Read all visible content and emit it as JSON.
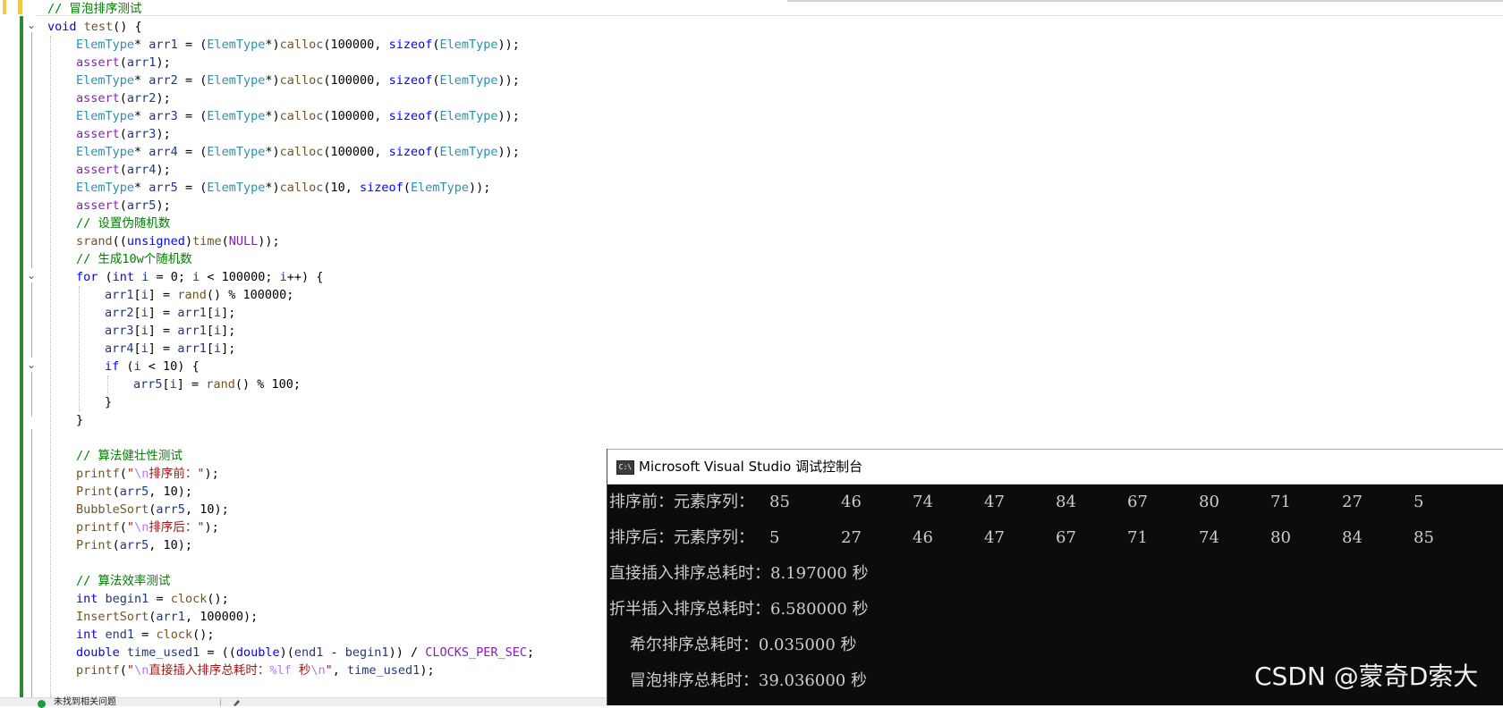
{
  "editor": {
    "lines": [
      {
        "indent": 0,
        "spans": [
          {
            "t": "// 冒泡排序测试",
            "c": "cm"
          }
        ]
      },
      {
        "indent": 0,
        "spans": [
          {
            "t": "void",
            "c": "kw"
          },
          {
            "t": " "
          },
          {
            "t": "test",
            "c": "fn"
          },
          {
            "t": "() {"
          }
        ]
      },
      {
        "indent": 1,
        "spans": [
          {
            "t": "ElemType",
            "c": "ty"
          },
          {
            "t": "* "
          },
          {
            "t": "arr1",
            "c": "vr"
          },
          {
            "t": " = ("
          },
          {
            "t": "ElemType",
            "c": "ty"
          },
          {
            "t": "*)"
          },
          {
            "t": "calloc",
            "c": "fn"
          },
          {
            "t": "(100000, "
          },
          {
            "t": "sizeof",
            "c": "kw"
          },
          {
            "t": "("
          },
          {
            "t": "ElemType",
            "c": "ty"
          },
          {
            "t": "));"
          }
        ]
      },
      {
        "indent": 1,
        "spans": [
          {
            "t": "assert",
            "c": "mc"
          },
          {
            "t": "("
          },
          {
            "t": "arr1",
            "c": "vr"
          },
          {
            "t": ");"
          }
        ]
      },
      {
        "indent": 1,
        "spans": [
          {
            "t": "ElemType",
            "c": "ty"
          },
          {
            "t": "* "
          },
          {
            "t": "arr2",
            "c": "vr"
          },
          {
            "t": " = ("
          },
          {
            "t": "ElemType",
            "c": "ty"
          },
          {
            "t": "*)"
          },
          {
            "t": "calloc",
            "c": "fn"
          },
          {
            "t": "(100000, "
          },
          {
            "t": "sizeof",
            "c": "kw"
          },
          {
            "t": "("
          },
          {
            "t": "ElemType",
            "c": "ty"
          },
          {
            "t": "));"
          }
        ]
      },
      {
        "indent": 1,
        "spans": [
          {
            "t": "assert",
            "c": "mc"
          },
          {
            "t": "("
          },
          {
            "t": "arr2",
            "c": "vr"
          },
          {
            "t": ");"
          }
        ]
      },
      {
        "indent": 1,
        "spans": [
          {
            "t": "ElemType",
            "c": "ty"
          },
          {
            "t": "* "
          },
          {
            "t": "arr3",
            "c": "vr"
          },
          {
            "t": " = ("
          },
          {
            "t": "ElemType",
            "c": "ty"
          },
          {
            "t": "*)"
          },
          {
            "t": "calloc",
            "c": "fn"
          },
          {
            "t": "(100000, "
          },
          {
            "t": "sizeof",
            "c": "kw"
          },
          {
            "t": "("
          },
          {
            "t": "ElemType",
            "c": "ty"
          },
          {
            "t": "));"
          }
        ]
      },
      {
        "indent": 1,
        "spans": [
          {
            "t": "assert",
            "c": "mc"
          },
          {
            "t": "("
          },
          {
            "t": "arr3",
            "c": "vr"
          },
          {
            "t": ");"
          }
        ]
      },
      {
        "indent": 1,
        "spans": [
          {
            "t": "ElemType",
            "c": "ty"
          },
          {
            "t": "* "
          },
          {
            "t": "arr4",
            "c": "vr"
          },
          {
            "t": " = ("
          },
          {
            "t": "ElemType",
            "c": "ty"
          },
          {
            "t": "*)"
          },
          {
            "t": "calloc",
            "c": "fn"
          },
          {
            "t": "(100000, "
          },
          {
            "t": "sizeof",
            "c": "kw"
          },
          {
            "t": "("
          },
          {
            "t": "ElemType",
            "c": "ty"
          },
          {
            "t": "));"
          }
        ]
      },
      {
        "indent": 1,
        "spans": [
          {
            "t": "assert",
            "c": "mc"
          },
          {
            "t": "("
          },
          {
            "t": "arr4",
            "c": "vr"
          },
          {
            "t": ");"
          }
        ]
      },
      {
        "indent": 1,
        "spans": [
          {
            "t": "ElemType",
            "c": "ty"
          },
          {
            "t": "* "
          },
          {
            "t": "arr5",
            "c": "vr"
          },
          {
            "t": " = ("
          },
          {
            "t": "ElemType",
            "c": "ty"
          },
          {
            "t": "*)"
          },
          {
            "t": "calloc",
            "c": "fn"
          },
          {
            "t": "(10, "
          },
          {
            "t": "sizeof",
            "c": "kw"
          },
          {
            "t": "("
          },
          {
            "t": "ElemType",
            "c": "ty"
          },
          {
            "t": "));"
          }
        ]
      },
      {
        "indent": 1,
        "spans": [
          {
            "t": "assert",
            "c": "mc"
          },
          {
            "t": "("
          },
          {
            "t": "arr5",
            "c": "vr"
          },
          {
            "t": ");"
          }
        ]
      },
      {
        "indent": 1,
        "spans": [
          {
            "t": "// 设置伪随机数",
            "c": "cm"
          }
        ]
      },
      {
        "indent": 1,
        "spans": [
          {
            "t": "srand",
            "c": "fn"
          },
          {
            "t": "(("
          },
          {
            "t": "unsigned",
            "c": "kw"
          },
          {
            "t": ")"
          },
          {
            "t": "time",
            "c": "fn"
          },
          {
            "t": "("
          },
          {
            "t": "NULL",
            "c": "mc"
          },
          {
            "t": "));"
          }
        ]
      },
      {
        "indent": 1,
        "spans": [
          {
            "t": "// 生成10w个随机数",
            "c": "cm"
          }
        ]
      },
      {
        "indent": 1,
        "spans": [
          {
            "t": "for",
            "c": "kw"
          },
          {
            "t": " ("
          },
          {
            "t": "int",
            "c": "kw"
          },
          {
            "t": " "
          },
          {
            "t": "i",
            "c": "vr"
          },
          {
            "t": " = 0; "
          },
          {
            "t": "i",
            "c": "vr"
          },
          {
            "t": " < 100000; "
          },
          {
            "t": "i",
            "c": "vr"
          },
          {
            "t": "++) {"
          }
        ]
      },
      {
        "indent": 2,
        "spans": [
          {
            "t": "arr1",
            "c": "vr"
          },
          {
            "t": "["
          },
          {
            "t": "i",
            "c": "vr"
          },
          {
            "t": "] = "
          },
          {
            "t": "rand",
            "c": "fn"
          },
          {
            "t": "() % 100000;"
          }
        ]
      },
      {
        "indent": 2,
        "spans": [
          {
            "t": "arr2",
            "c": "vr"
          },
          {
            "t": "["
          },
          {
            "t": "i",
            "c": "vr"
          },
          {
            "t": "] = "
          },
          {
            "t": "arr1",
            "c": "vr"
          },
          {
            "t": "["
          },
          {
            "t": "i",
            "c": "vr"
          },
          {
            "t": "];"
          }
        ]
      },
      {
        "indent": 2,
        "spans": [
          {
            "t": "arr3",
            "c": "vr"
          },
          {
            "t": "["
          },
          {
            "t": "i",
            "c": "vr"
          },
          {
            "t": "] = "
          },
          {
            "t": "arr1",
            "c": "vr"
          },
          {
            "t": "["
          },
          {
            "t": "i",
            "c": "vr"
          },
          {
            "t": "];"
          }
        ]
      },
      {
        "indent": 2,
        "spans": [
          {
            "t": "arr4",
            "c": "vr"
          },
          {
            "t": "["
          },
          {
            "t": "i",
            "c": "vr"
          },
          {
            "t": "] = "
          },
          {
            "t": "arr1",
            "c": "vr"
          },
          {
            "t": "["
          },
          {
            "t": "i",
            "c": "vr"
          },
          {
            "t": "];"
          }
        ]
      },
      {
        "indent": 2,
        "spans": [
          {
            "t": "if",
            "c": "kw"
          },
          {
            "t": " ("
          },
          {
            "t": "i",
            "c": "vr"
          },
          {
            "t": " < 10) {"
          }
        ]
      },
      {
        "indent": 3,
        "spans": [
          {
            "t": "arr5",
            "c": "vr"
          },
          {
            "t": "["
          },
          {
            "t": "i",
            "c": "vr"
          },
          {
            "t": "] = "
          },
          {
            "t": "rand",
            "c": "fn"
          },
          {
            "t": "() % 100;"
          }
        ]
      },
      {
        "indent": 2,
        "spans": [
          {
            "t": "}"
          }
        ]
      },
      {
        "indent": 1,
        "spans": [
          {
            "t": "}"
          }
        ]
      },
      {
        "indent": 0,
        "spans": []
      },
      {
        "indent": 1,
        "spans": [
          {
            "t": "// 算法健壮性测试",
            "c": "cm"
          }
        ]
      },
      {
        "indent": 1,
        "spans": [
          {
            "t": "printf",
            "c": "fn"
          },
          {
            "t": "("
          },
          {
            "t": "\"",
            "c": "st"
          },
          {
            "t": "\\n",
            "c": "es"
          },
          {
            "t": "排序前：\"",
            "c": "st"
          },
          {
            "t": ");"
          }
        ]
      },
      {
        "indent": 1,
        "spans": [
          {
            "t": "Print",
            "c": "fn"
          },
          {
            "t": "("
          },
          {
            "t": "arr5",
            "c": "vr"
          },
          {
            "t": ", 10);"
          }
        ]
      },
      {
        "indent": 1,
        "spans": [
          {
            "t": "BubbleSort",
            "c": "fn"
          },
          {
            "t": "("
          },
          {
            "t": "arr5",
            "c": "vr"
          },
          {
            "t": ", 10);"
          }
        ]
      },
      {
        "indent": 1,
        "spans": [
          {
            "t": "printf",
            "c": "fn"
          },
          {
            "t": "("
          },
          {
            "t": "\"",
            "c": "st"
          },
          {
            "t": "\\n",
            "c": "es"
          },
          {
            "t": "排序后：\"",
            "c": "st"
          },
          {
            "t": ");"
          }
        ]
      },
      {
        "indent": 1,
        "spans": [
          {
            "t": "Print",
            "c": "fn"
          },
          {
            "t": "("
          },
          {
            "t": "arr5",
            "c": "vr"
          },
          {
            "t": ", 10);"
          }
        ]
      },
      {
        "indent": 0,
        "spans": []
      },
      {
        "indent": 1,
        "spans": [
          {
            "t": "// 算法效率测试",
            "c": "cm"
          }
        ]
      },
      {
        "indent": 1,
        "spans": [
          {
            "t": "int",
            "c": "kw"
          },
          {
            "t": " "
          },
          {
            "t": "begin1",
            "c": "vr"
          },
          {
            "t": " = "
          },
          {
            "t": "clock",
            "c": "fn"
          },
          {
            "t": "();"
          }
        ]
      },
      {
        "indent": 1,
        "spans": [
          {
            "t": "InsertSort",
            "c": "fn"
          },
          {
            "t": "("
          },
          {
            "t": "arr1",
            "c": "vr"
          },
          {
            "t": ", 100000);"
          }
        ]
      },
      {
        "indent": 1,
        "spans": [
          {
            "t": "int",
            "c": "kw"
          },
          {
            "t": " "
          },
          {
            "t": "end1",
            "c": "vr"
          },
          {
            "t": " = "
          },
          {
            "t": "clock",
            "c": "fn"
          },
          {
            "t": "();"
          }
        ]
      },
      {
        "indent": 1,
        "spans": [
          {
            "t": "double",
            "c": "kw"
          },
          {
            "t": " "
          },
          {
            "t": "time_used1",
            "c": "vr"
          },
          {
            "t": " = (("
          },
          {
            "t": "double",
            "c": "kw"
          },
          {
            "t": ")("
          },
          {
            "t": "end1",
            "c": "vr"
          },
          {
            "t": " - "
          },
          {
            "t": "begin1",
            "c": "vr"
          },
          {
            "t": ")) / "
          },
          {
            "t": "CLOCKS_PER_SEC",
            "c": "mc"
          },
          {
            "t": ";"
          }
        ]
      },
      {
        "indent": 1,
        "spans": [
          {
            "t": "printf",
            "c": "fn"
          },
          {
            "t": "("
          },
          {
            "t": "\"",
            "c": "st"
          },
          {
            "t": "\\n",
            "c": "es"
          },
          {
            "t": "直接插入排序总耗时：",
            "c": "st"
          },
          {
            "t": "%lf",
            "c": "es"
          },
          {
            "t": " 秒",
            "c": "st"
          },
          {
            "t": "\\n",
            "c": "es"
          },
          {
            "t": "\"",
            "c": "st"
          },
          {
            "t": ", "
          },
          {
            "t": "time_used1",
            "c": "vr"
          },
          {
            "t": ");"
          }
        ]
      }
    ]
  },
  "status_bar": {
    "text": "未找到相关问题",
    "icon": "check-circle-icon"
  },
  "console": {
    "title": "Microsoft Visual Studio 调试控制台",
    "icon_glyph": "C:\\",
    "lines": [
      {
        "label": "排序前：元素序列：",
        "values": [
          "85",
          "46",
          "74",
          "47",
          "84",
          "67",
          "80",
          "71",
          "27",
          "5"
        ]
      },
      {
        "label": "排序后：元素序列：",
        "values": [
          "5",
          "27",
          "46",
          "47",
          "67",
          "71",
          "74",
          "80",
          "84",
          "85"
        ]
      },
      {
        "text": "直接插入排序总耗时：8.197000 秒"
      },
      {
        "text": "折半插入排序总耗时：6.580000 秒"
      },
      {
        "text": "    希尔排序总耗时：0.035000 秒"
      },
      {
        "text": "    冒泡排序总耗时：39.036000 秒"
      }
    ]
  },
  "watermark": "CSDN @蒙奇D索大"
}
